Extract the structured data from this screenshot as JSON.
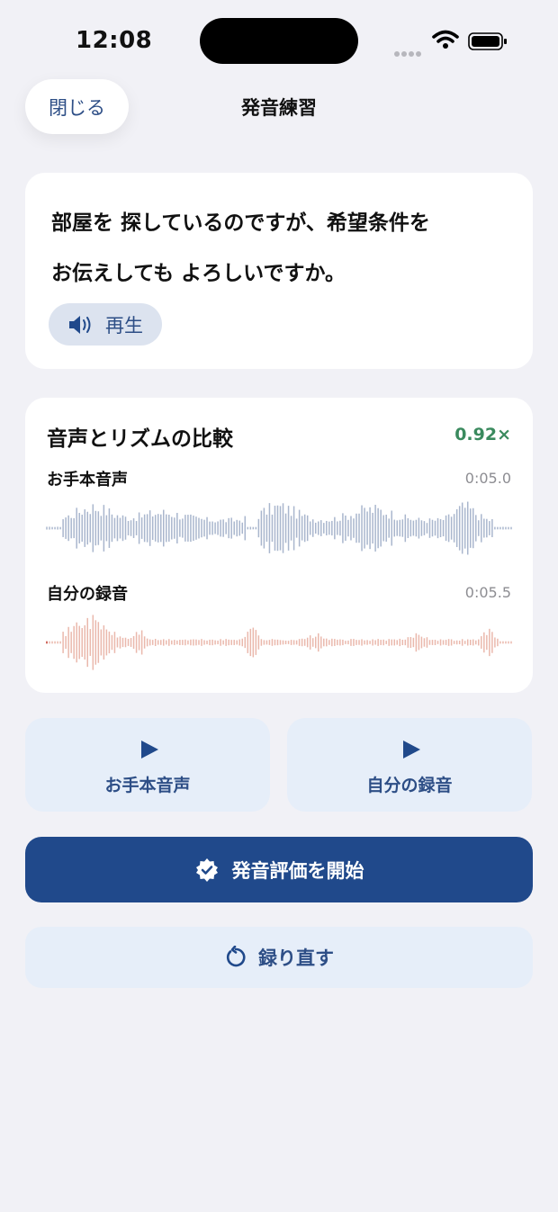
{
  "status_bar": {
    "time": "12:08"
  },
  "nav": {
    "close_label": "閉じる",
    "title": "発音練習"
  },
  "sentence": {
    "lines": [
      "部屋を 探しているのですが、希望条件を",
      "お伝えしても よろしいですか。"
    ],
    "play_label": "再生"
  },
  "comparison": {
    "title": "音声とリズムの比較",
    "speed_ratio": "0.92×",
    "reference": {
      "label": "お手本音声",
      "duration": "0:05.0",
      "color": "#a9b6cd"
    },
    "recording": {
      "label": "自分の録音",
      "duration": "0:05.5",
      "color": "#eab8ac",
      "start_marker_color": "#c0392b"
    }
  },
  "playback_buttons": {
    "reference_label": "お手本音声",
    "recording_label": "自分の録音"
  },
  "actions": {
    "evaluate_label": "発音評価を開始",
    "retake_label": "録り直す"
  },
  "icons": {
    "signal": "signal-dots-icon",
    "wifi": "wifi-icon",
    "battery": "battery-icon",
    "speaker": "speaker-icon",
    "play": "play-icon",
    "verified": "verified-badge-icon",
    "retry": "retry-icon"
  }
}
